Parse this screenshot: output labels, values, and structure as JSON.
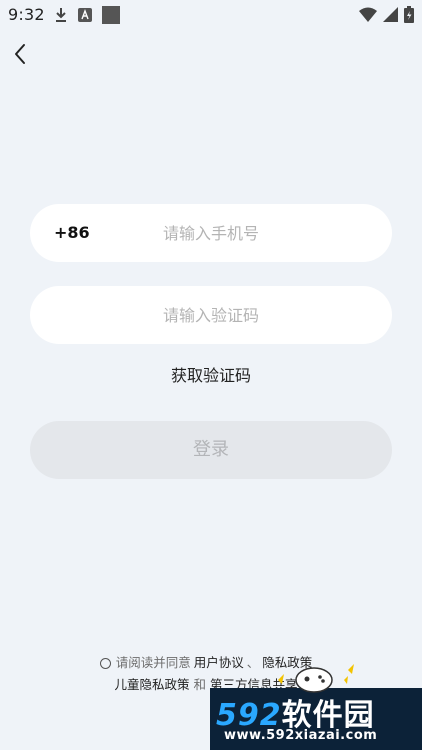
{
  "status_bar": {
    "time": "9:32"
  },
  "form": {
    "country_code": "+86",
    "phone_placeholder": "请输入手机号",
    "code_placeholder": "请输入验证码",
    "get_code_label": "获取验证码",
    "login_label": "登录"
  },
  "agreement": {
    "prefix": "请阅读并同意",
    "user_agreement": "用户协议",
    "sep": "、",
    "privacy_policy": "隐私政策",
    "children_privacy": "儿童隐私政策",
    "and": "和",
    "third_party": "第三方信息共享"
  },
  "watermark": {
    "brand_num": "592",
    "brand_cn": "软件园",
    "url": "www.592xiazai.com"
  },
  "colors": {
    "background": "#eff3f8",
    "field": "#ffffff",
    "login_disabled": "#e4e7eb",
    "watermark_blue": "#2aa8ff",
    "watermark_bg": "#0c2238"
  }
}
